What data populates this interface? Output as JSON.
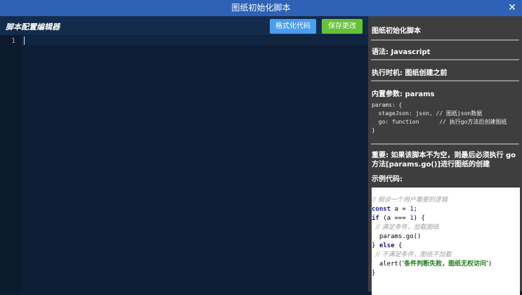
{
  "window": {
    "title": "图纸初始化脚本",
    "close_icon": "✕"
  },
  "editor": {
    "title": "脚本配置编辑器",
    "format_label": "格式化代码",
    "save_label": "保存更改",
    "line_numbers": [
      "1"
    ],
    "content": ""
  },
  "info": {
    "heading": "图纸初始化脚本",
    "language": "语法: Javascript",
    "timing": "执行时机: 图纸创建之前",
    "params_title": "内置参数: params",
    "params_code": "params: {\n  stageJson: json, // 图纸json数据\n  go: function      // 执行go方法后创建图纸\n}",
    "important": "重要: 如果该脚本不为空，则最后必须执行 go 方法[params.go()]进行图纸的创建",
    "example_title": "示例代码:",
    "example_lines": {
      "l1": "// 假设一个用户需要的逻辑",
      "l2_kw": "const",
      "l2_rest": " a = ",
      "l2_num": "1",
      "l2_end": ";",
      "l3_kw": "if",
      "l3_a": " (a === ",
      "l3_num": "1",
      "l3_b": ") {",
      "l4": "  // 满足条件，加载图纸",
      "l5": "  params.go()",
      "l6_a": "} ",
      "l6_kw": "else",
      "l6_b": " {",
      "l7": "  // 不满足条件，图纸不加载",
      "l8_a": "  alert(",
      "l8_str": "'条件判断失败，图纸无权访问'",
      "l8_b": ")",
      "l9": "}"
    }
  },
  "colors": {
    "titlebar": "#2d62b6",
    "format_button": "#4a9ef1",
    "save_button": "#65c237",
    "editor_bg": "#0e1d33",
    "panel_bg": "#3e3e3e"
  }
}
